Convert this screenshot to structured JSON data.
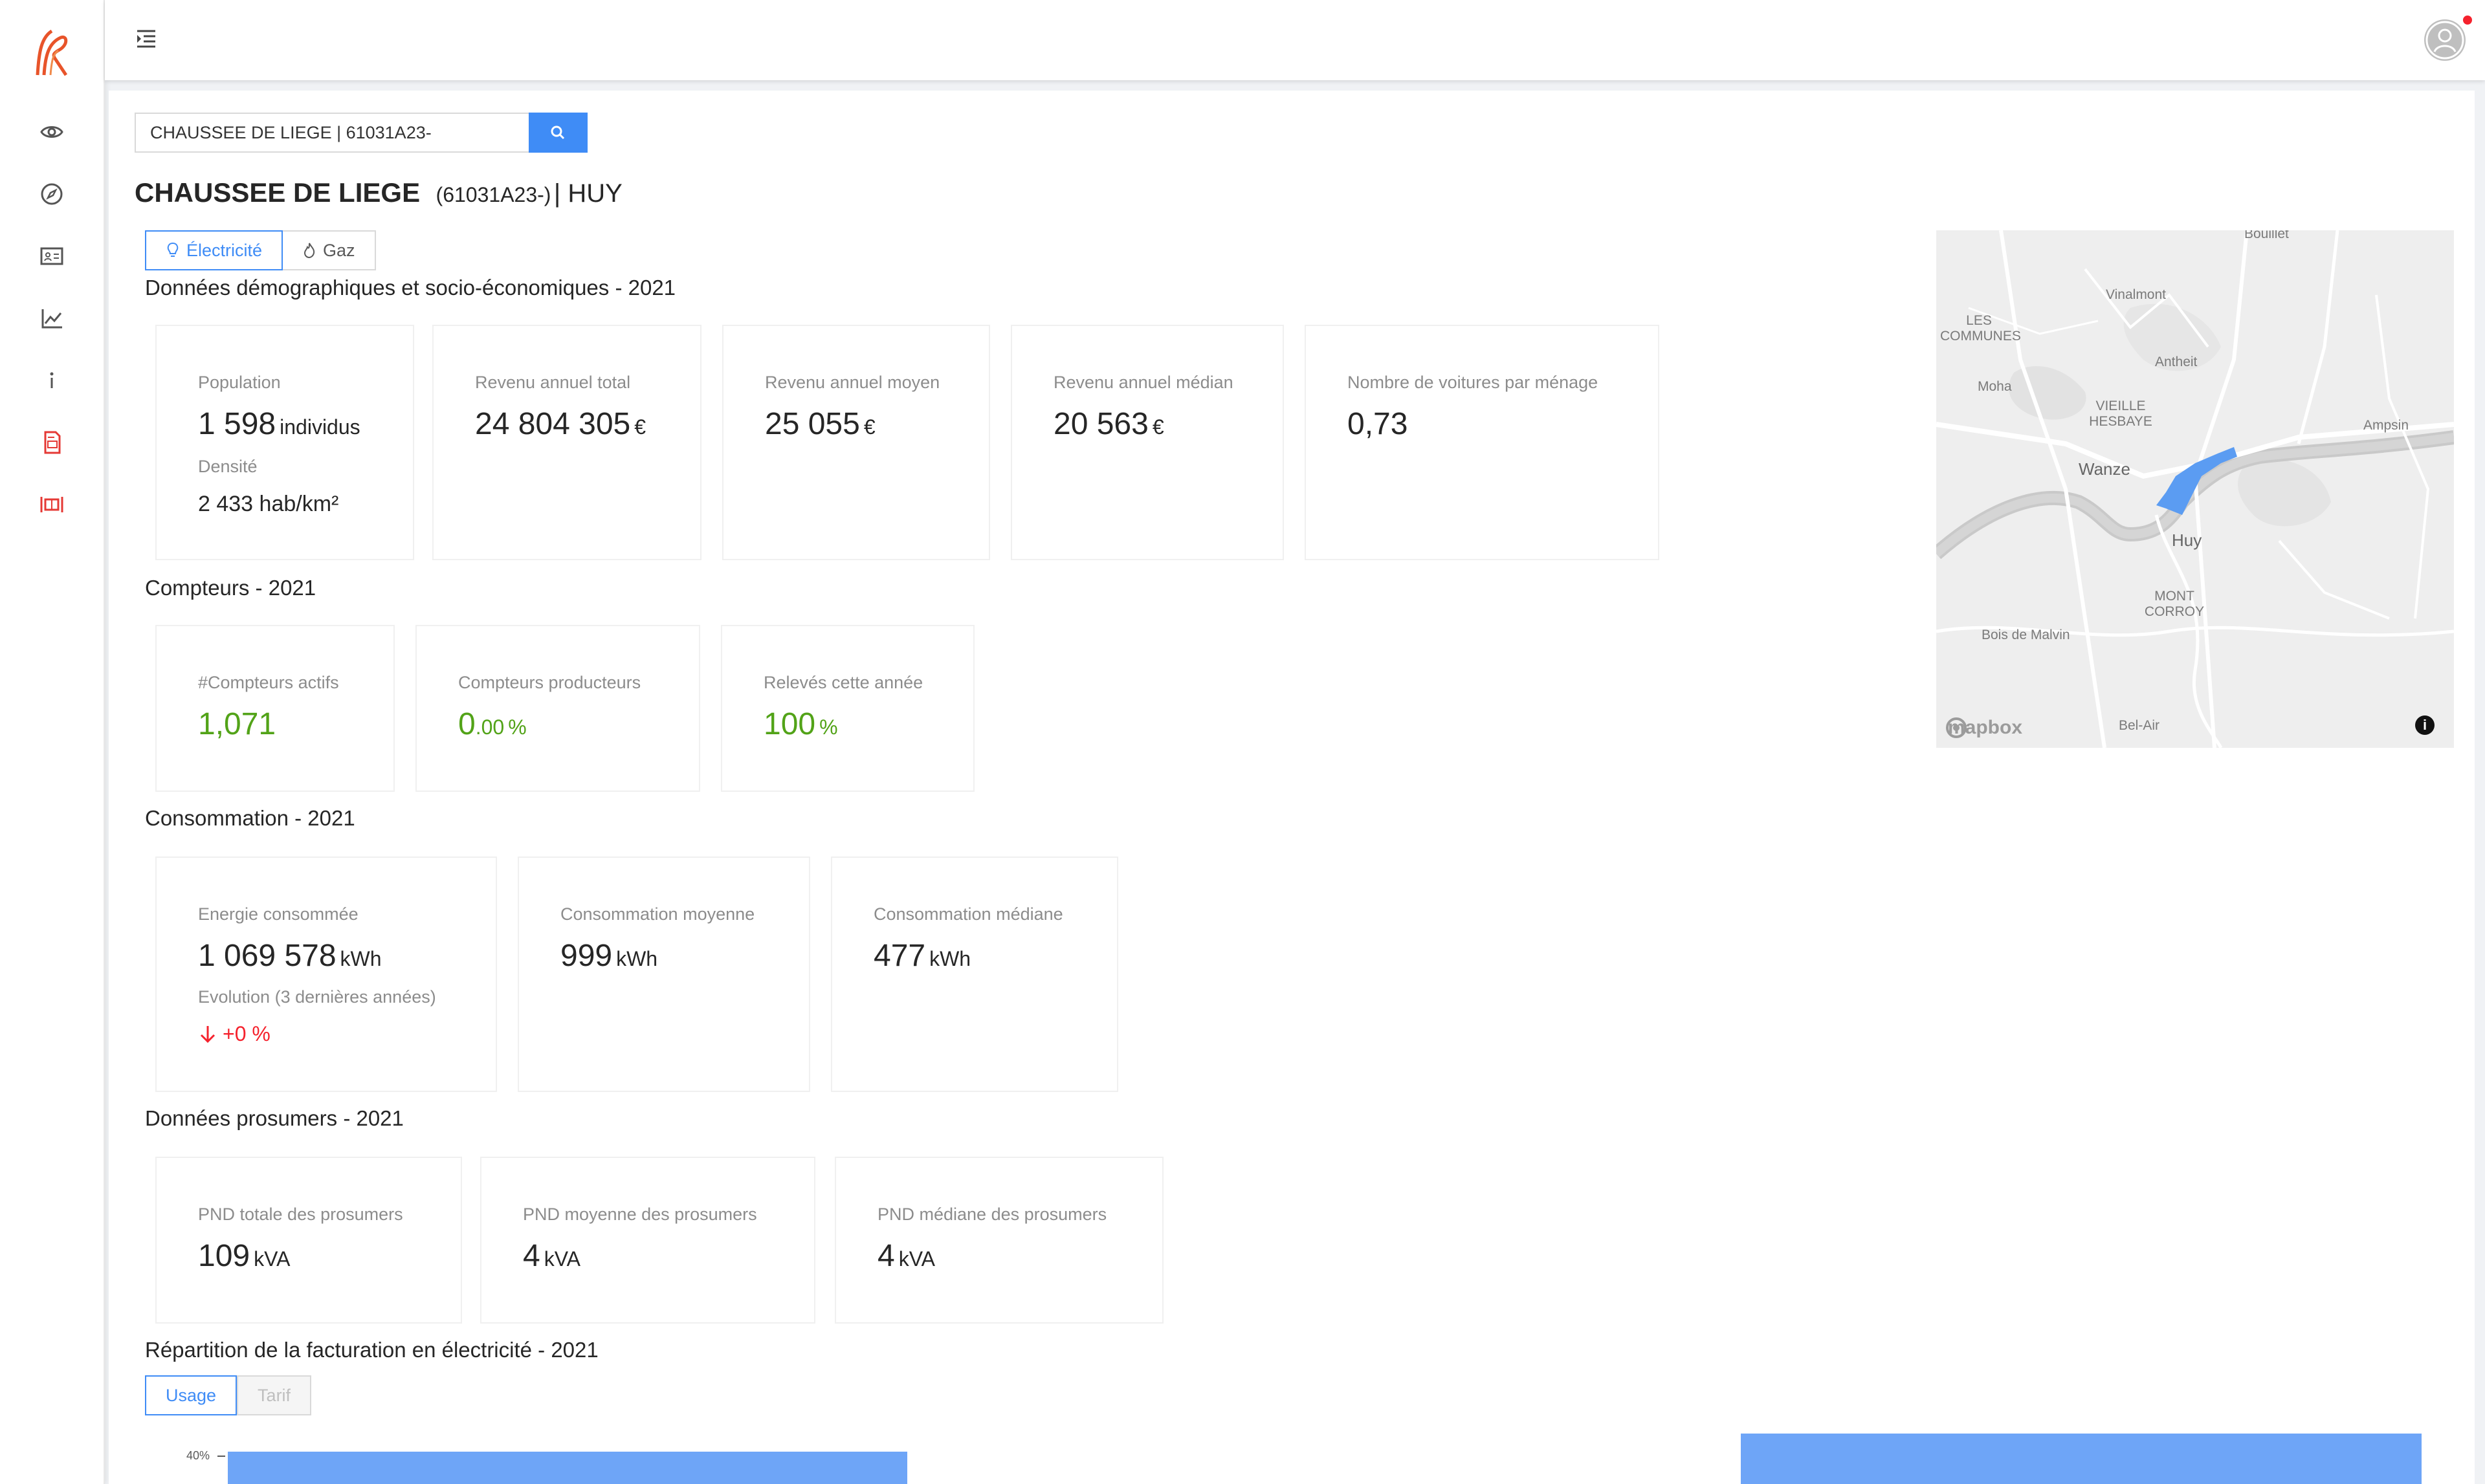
{
  "header": {
    "menu_icon": "menu-fold-icon",
    "avatar_icon": "user-icon",
    "notification_dot_color": "#f5222d"
  },
  "sidebar": {
    "items": [
      {
        "icon": "eye-icon"
      },
      {
        "icon": "compass-icon"
      },
      {
        "icon": "id-card-icon"
      },
      {
        "icon": "line-chart-icon"
      },
      {
        "icon": "info-icon"
      },
      {
        "icon": "file-pdf-icon"
      },
      {
        "icon": "column-width-icon"
      }
    ]
  },
  "search": {
    "value": "CHAUSSEE DE LIEGE | 61031A23-",
    "button_icon": "search-icon"
  },
  "title": {
    "name": "CHAUSSEE DE LIEGE",
    "code": "(61031A23-)",
    "city": "| HUY"
  },
  "energy_tabs": [
    {
      "label": "Électricité",
      "icon": "bulb-icon",
      "active": true
    },
    {
      "label": "Gaz",
      "icon": "fire-icon",
      "active": false
    }
  ],
  "sections": {
    "demographics": {
      "title": "Données démographiques et socio-économiques - 2021",
      "population": {
        "label": "Population",
        "value": "1 598",
        "unit": "individus",
        "density_label": "Densité",
        "density_value": "2 433 hab/km²"
      },
      "revenue_total": {
        "label": "Revenu annuel total",
        "value": "24 804 305",
        "unit": "€"
      },
      "revenue_mean": {
        "label": "Revenu annuel moyen",
        "value": "25 055",
        "unit": "€"
      },
      "revenue_median": {
        "label": "Revenu annuel médian",
        "value": "20 563",
        "unit": "€"
      },
      "cars": {
        "label": "Nombre de voitures par ménage",
        "value": "0,73"
      }
    },
    "meters": {
      "title": "Compteurs - 2021",
      "active": {
        "label": "#Compteurs actifs",
        "value": "1,071"
      },
      "producers": {
        "label": "Compteurs producteurs",
        "value_int": "0",
        "value_dec": ".00",
        "unit": "%"
      },
      "readings": {
        "label": "Relevés cette année",
        "value": "100",
        "unit": "%"
      }
    },
    "consumption": {
      "title": "Consommation - 2021",
      "energy": {
        "label": "Energie consommée",
        "value": "1 069 578",
        "unit": "kWh",
        "evolution_label": "Evolution (3 dernières années)",
        "evolution_value": "+0 %",
        "evolution_icon": "arrow-down-icon"
      },
      "mean": {
        "label": "Consommation moyenne",
        "value": "999",
        "unit": "kWh"
      },
      "median": {
        "label": "Consommation médiane",
        "value": "477",
        "unit": "kWh"
      }
    },
    "prosumers": {
      "title": "Données prosumers - 2021",
      "total": {
        "label": "PND totale des prosumers",
        "value": "109",
        "unit": "kVA"
      },
      "mean": {
        "label": "PND moyenne des prosumers",
        "value": "4",
        "unit": "kVA"
      },
      "median": {
        "label": "PND médiane des prosumers",
        "value": "4",
        "unit": "kVA"
      }
    },
    "billing": {
      "title": "Répartition de la facturation en électricité - 2021",
      "tabs": [
        {
          "label": "Usage",
          "active": true
        },
        {
          "label": "Tarif",
          "active": false
        }
      ],
      "axis_top_label": "40%"
    }
  },
  "map": {
    "labels": [
      "Bouillet",
      "Vinalmont",
      "LES COMMUNES",
      "Antheit",
      "Moha",
      "VIEILLE HESBAYE",
      "Ampsin",
      "Wanze",
      "Huy",
      "MONT CORROY",
      "Bois de Malvin",
      "Bel-Air"
    ],
    "attribution": "mapbox",
    "highlight_color": "#5b9cf2"
  },
  "chart_data": {
    "type": "bar",
    "ytick_labels": [
      "40%"
    ],
    "series_color": "#6ea5f7"
  }
}
